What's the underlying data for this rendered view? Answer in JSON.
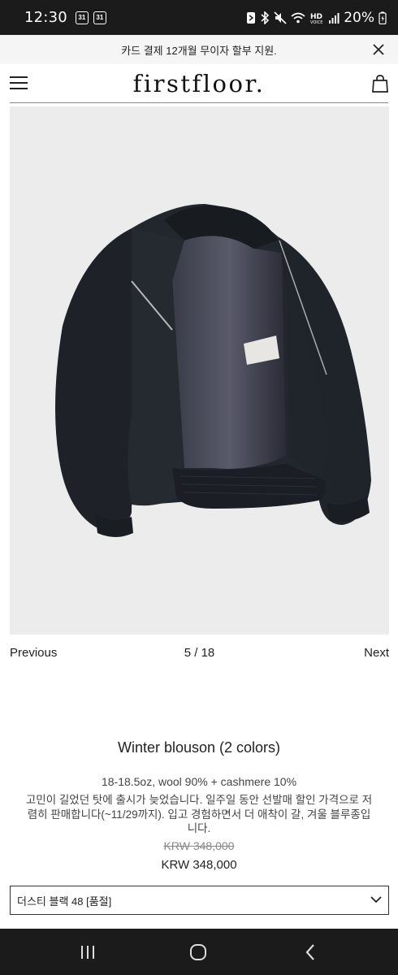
{
  "status_bar": {
    "time": "12:30",
    "calendar_badges": [
      "31",
      "31"
    ],
    "battery_percent": "20%",
    "icons": [
      "nfc-icon",
      "bluetooth-icon",
      "mute-icon",
      "wifi-icon",
      "hd-voice-icon",
      "signal-icon",
      "battery-icon"
    ]
  },
  "announcement": {
    "text": "카드 결제 12개월 무이자 할부 지원."
  },
  "header": {
    "logo": "firstfloor."
  },
  "gallery": {
    "prev_label": "Previous",
    "counter": "5 / 18",
    "next_label": "Next"
  },
  "product": {
    "title": "Winter blouson (2 colors)",
    "spec": "18-18.5oz, wool 90% + cashmere 10%",
    "description_lines": [
      "고민이 길었던 탓에 출시가 늦었습니다. 일주일 동안 선발매 할인 가격으로 저",
      "렴히 판매합니다(~11/29까지). 입고 경험하면서 더 애착이 갈, 겨울 블루종입",
      "니다."
    ],
    "price_original": "KRW 348,000",
    "price_current": "KRW 348,000",
    "image_subject": "black wool zip-up blouson jacket"
  },
  "option_select": {
    "selected": "더스티 블랙 48 [품절]"
  },
  "colors": {
    "status_bar_bg": "#1b1b1b",
    "image_bg": "#ececec",
    "jacket": "#1f2329"
  }
}
